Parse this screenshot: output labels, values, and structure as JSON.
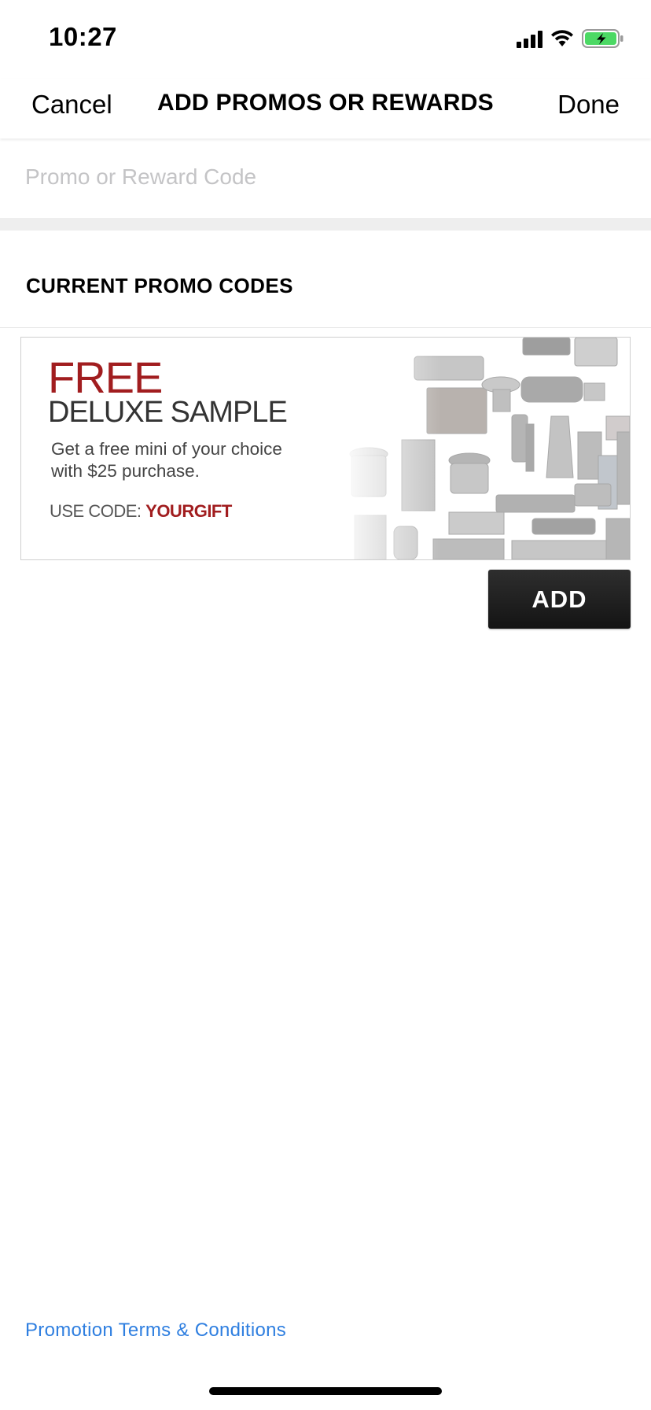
{
  "status_bar": {
    "time": "10:27",
    "icons": [
      "signal-icon",
      "wifi-icon",
      "battery-charging-icon"
    ],
    "battery_color": "#4cd964"
  },
  "nav": {
    "cancel_label": "Cancel",
    "title": "ADD PROMOS OR REWARDS",
    "done_label": "Done"
  },
  "promo_input": {
    "value": "",
    "placeholder": "Promo or Reward Code"
  },
  "current_promos": {
    "header": "CURRENT PROMO CODES",
    "items": [
      {
        "headline": "FREE",
        "subheadline": "DELUXE SAMPLE",
        "description": "Get a free mini of your choice\nwith $25 purchase.",
        "code_label": "USE CODE: ",
        "code": "YOURGIFT",
        "add_label": "ADD"
      }
    ]
  },
  "footer": {
    "terms_label": "Promotion Terms & Conditions"
  },
  "colors": {
    "accent_red": "#a11d1f",
    "link_blue": "#2f7fe0",
    "button_dark": "#1f1f1f"
  }
}
